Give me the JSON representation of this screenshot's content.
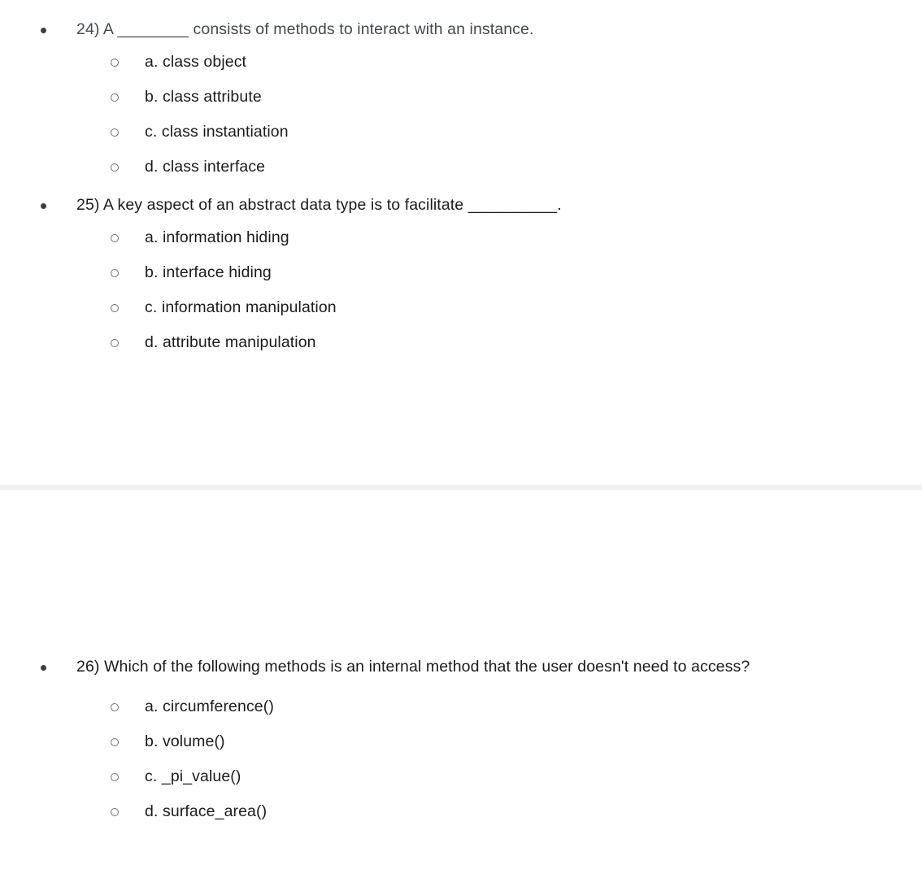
{
  "document": {
    "background_color": "#ffffff",
    "question_text_color_muted": "#45494d",
    "question_text_color": "#1b1b1b",
    "option_text_color": "#1b1b1b",
    "bullet_color": "#3c4043",
    "option_marker_color": "#6b6f73",
    "divider_color": "#f1f2f3"
  },
  "questions": [
    {
      "id": "q24",
      "prompt": "24) A ________ consists of methods to interact with an instance.",
      "options": [
        {
          "key": "a",
          "label": "a. class object"
        },
        {
          "key": "b",
          "label": "b. class attribute"
        },
        {
          "key": "c",
          "label": "c. class instantiation"
        },
        {
          "key": "d",
          "label": "d. class interface"
        }
      ]
    },
    {
      "id": "q25",
      "prompt": "25) A key aspect of an abstract data type is to facilitate __________.",
      "options": [
        {
          "key": "a",
          "label": "a. information hiding"
        },
        {
          "key": "b",
          "label": "b. interface hiding"
        },
        {
          "key": "c",
          "label": "c. information manipulation"
        },
        {
          "key": "d",
          "label": "d. attribute manipulation"
        }
      ]
    },
    {
      "id": "q26",
      "prompt": "26) Which of the following methods is an internal method that the user doesn't need to access?",
      "options": [
        {
          "key": "a",
          "label": "a. circumference()"
        },
        {
          "key": "b",
          "label": "b. volume()"
        },
        {
          "key": "c",
          "label": "c. _pi_value()"
        },
        {
          "key": "d",
          "label": "d. surface_area()"
        }
      ]
    }
  ]
}
